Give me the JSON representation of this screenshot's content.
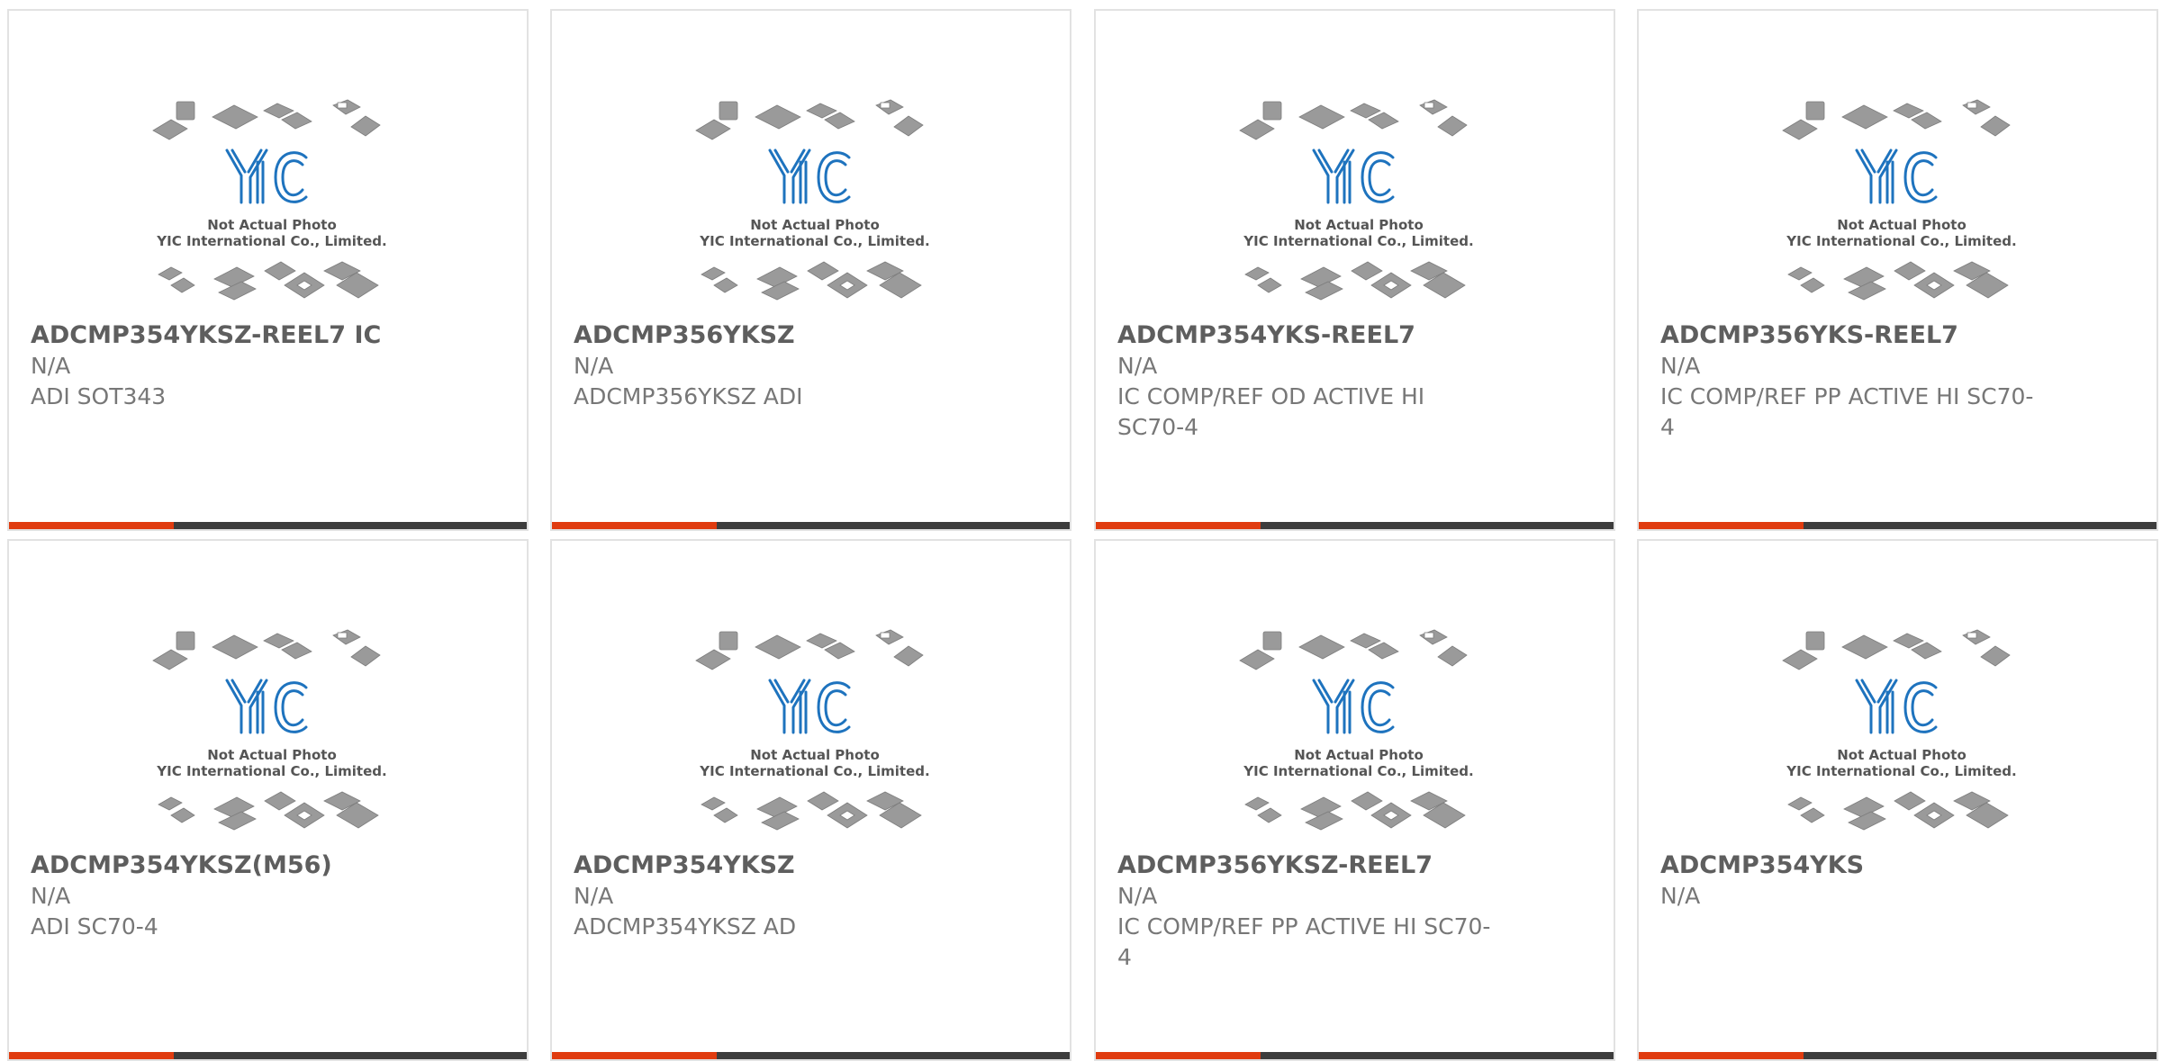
{
  "colors": {
    "accent_bar": "#e03c10",
    "dark_bar": "#3d3d3d",
    "logo_blue": "#1e73be",
    "chip_gray": "#9a9a9a"
  },
  "placeholder": {
    "logo_text": "YIC",
    "caption_line1": "Not Actual Photo",
    "caption_line2": "YIC International Co., Limited."
  },
  "products": [
    {
      "part": "ADCMP354YKSZ-REEL7 IC",
      "stock": "N/A",
      "desc": "ADI SOT343"
    },
    {
      "part": "ADCMP356YKSZ",
      "stock": "N/A",
      "desc": "ADCMP356YKSZ ADI"
    },
    {
      "part": "ADCMP354YKS-REEL7",
      "stock": "N/A",
      "desc": "IC COMP/REF OD ACTIVE HI SC70-4"
    },
    {
      "part": "ADCMP356YKS-REEL7",
      "stock": "N/A",
      "desc": "IC COMP/REF PP ACTIVE HI SC70-4"
    },
    {
      "part": "ADCMP354YKSZ(M56)",
      "stock": "N/A",
      "desc": "ADI SC70-4"
    },
    {
      "part": "ADCMP354YKSZ",
      "stock": "N/A",
      "desc": "ADCMP354YKSZ AD"
    },
    {
      "part": "ADCMP356YKSZ-REEL7",
      "stock": "N/A",
      "desc": "IC COMP/REF PP ACTIVE HI SC70-4"
    },
    {
      "part": "ADCMP354YKS",
      "stock": "N/A",
      "desc": ""
    }
  ]
}
